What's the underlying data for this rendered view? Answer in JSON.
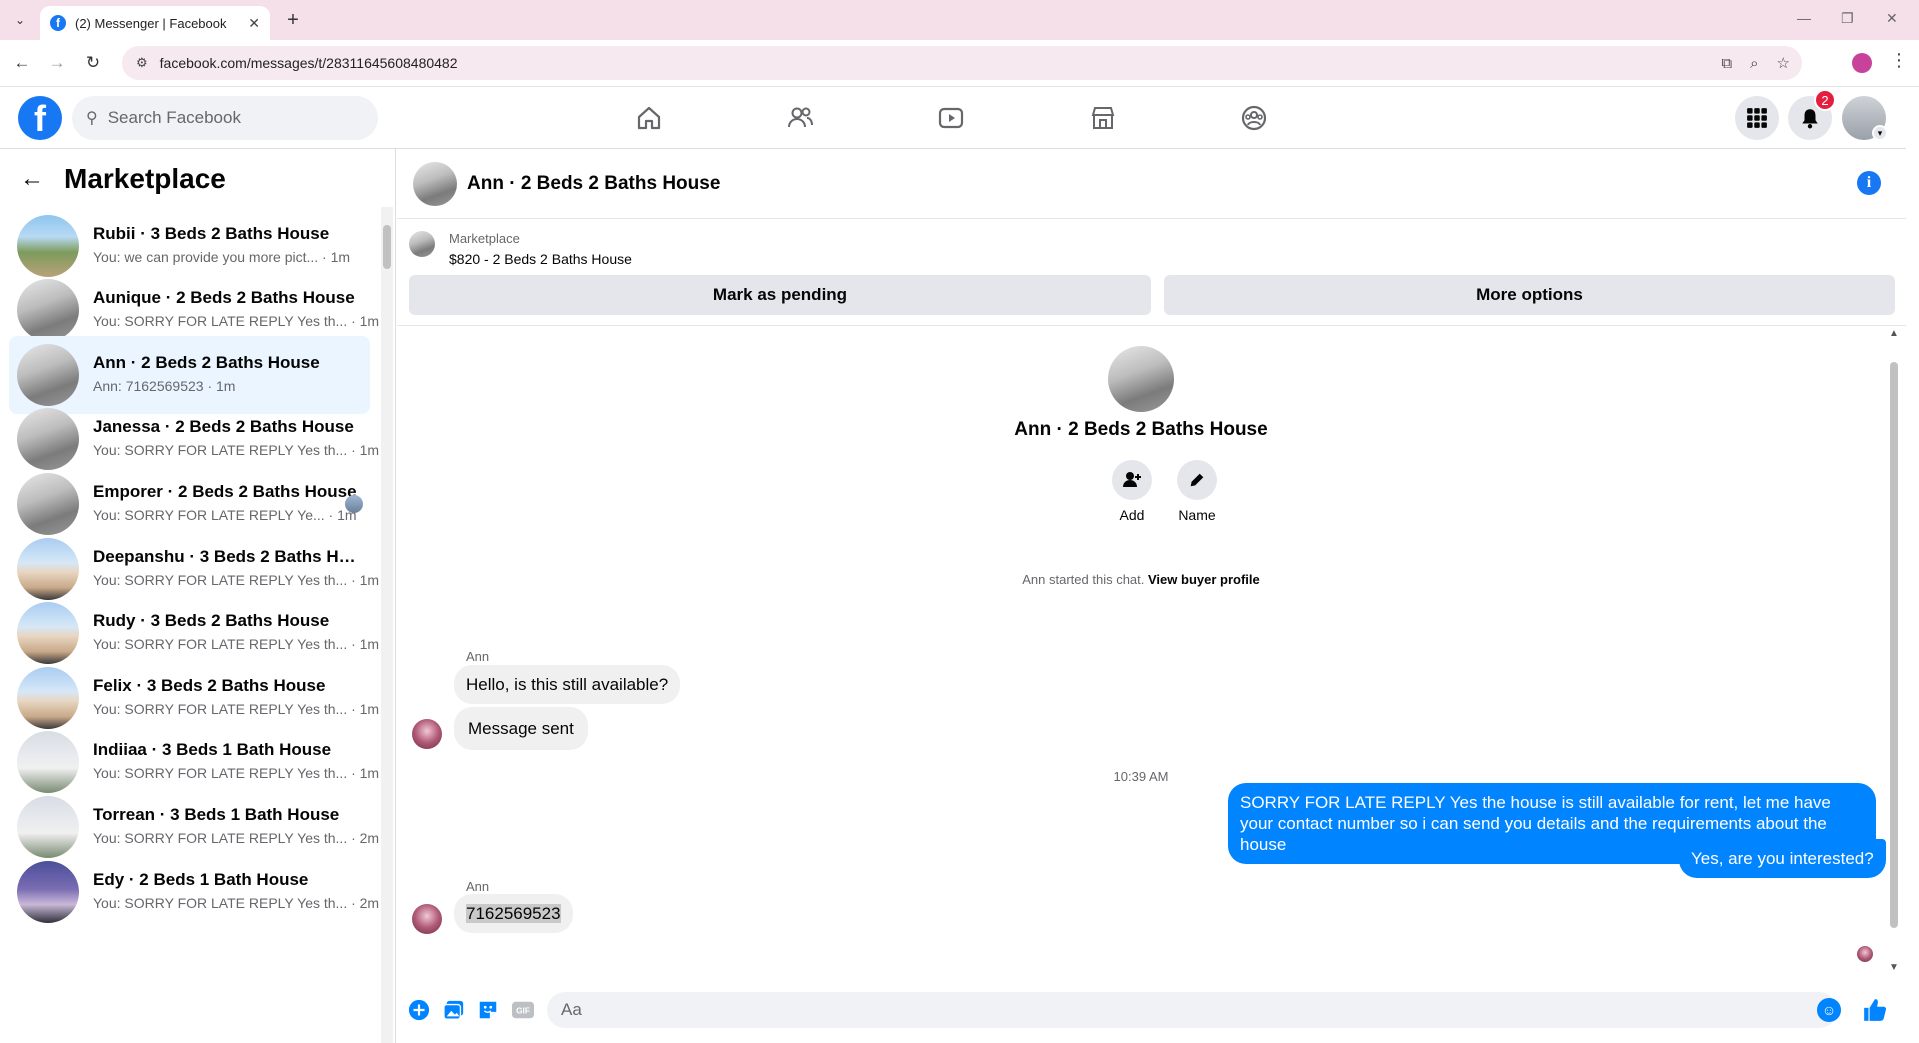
{
  "browser": {
    "tab_title": "(2) Messenger | Facebook",
    "url": "facebook.com/messages/t/28311645608480482"
  },
  "header": {
    "search_placeholder": "Search Facebook",
    "notification_count": "2",
    "brand_color": "#1877f2"
  },
  "sidebar": {
    "title": "Marketplace",
    "conversations": [
      {
        "name": "Rubii · 3 Beds 2 Baths House",
        "preview": "You: we can provide you more pict... · 1m",
        "thumb": "yard"
      },
      {
        "name": "Aunique · 2 Beds 2 Baths House",
        "preview": "You: SORRY FOR LATE REPLY Yes th... · 1m",
        "thumb": "room"
      },
      {
        "name": "Ann · 2 Beds 2 Baths House",
        "preview": "Ann: 7162569523 · 1m",
        "thumb": "room",
        "active": true
      },
      {
        "name": "Janessa · 2 Beds 2 Baths House",
        "preview": "You: SORRY FOR LATE REPLY Yes th... · 1m",
        "thumb": "room"
      },
      {
        "name": "Emporer · 2 Beds 2 Baths House",
        "preview": "You: SORRY FOR LATE REPLY Ye... · 1m",
        "thumb": "room"
      },
      {
        "name": "Deepanshu · 3 Beds 2 Baths House",
        "preview": "You: SORRY FOR LATE REPLY Yes th... · 1m",
        "thumb": "house"
      },
      {
        "name": "Rudy · 3 Beds 2 Baths House",
        "preview": "You: SORRY FOR LATE REPLY Yes th... · 1m",
        "thumb": "house"
      },
      {
        "name": "Felix · 3 Beds 2 Baths House",
        "preview": "You: SORRY FOR LATE REPLY Yes th... · 1m",
        "thumb": "house"
      },
      {
        "name": "Indiiaa · 3 Beds 1 Bath House",
        "preview": "You: SORRY FOR LATE REPLY Yes th... · 1m",
        "thumb": "house2"
      },
      {
        "name": "Torrean · 3 Beds 1 Bath House",
        "preview": "You: SORRY FOR LATE REPLY Yes th... · 2m",
        "thumb": "house2"
      },
      {
        "name": "Edy · 2 Beds 1 Bath House",
        "preview": "You: SORRY FOR LATE REPLY Yes th... · 2m",
        "thumb": "dusk"
      }
    ]
  },
  "chat": {
    "title": "Ann · 2 Beds 2 Baths House",
    "listing_source": "Marketplace",
    "listing_price": "$820 - 2 Beds 2 Baths House",
    "mark_pending_label": "Mark as pending",
    "more_options_label": "More options",
    "profile_name": "Ann · 2 Beds 2 Baths House",
    "add_label": "Add",
    "name_label": "Name",
    "started_text": "Ann started this chat.",
    "view_profile_label": "View buyer profile",
    "sender_name": "Ann",
    "sender_name_2": "Ann",
    "msg1": "Hello, is this still available?",
    "msg2": "Message sent",
    "timestamp": "10:39 AM",
    "out1": "SORRY FOR LATE REPLY Yes the house is still available for rent, let me have your contact number so i can send you details and the requirements about the house",
    "out2": "Yes, are you interested?",
    "msg3": "7162569523",
    "composer_placeholder": "Aa",
    "accent_color": "#0084ff"
  }
}
